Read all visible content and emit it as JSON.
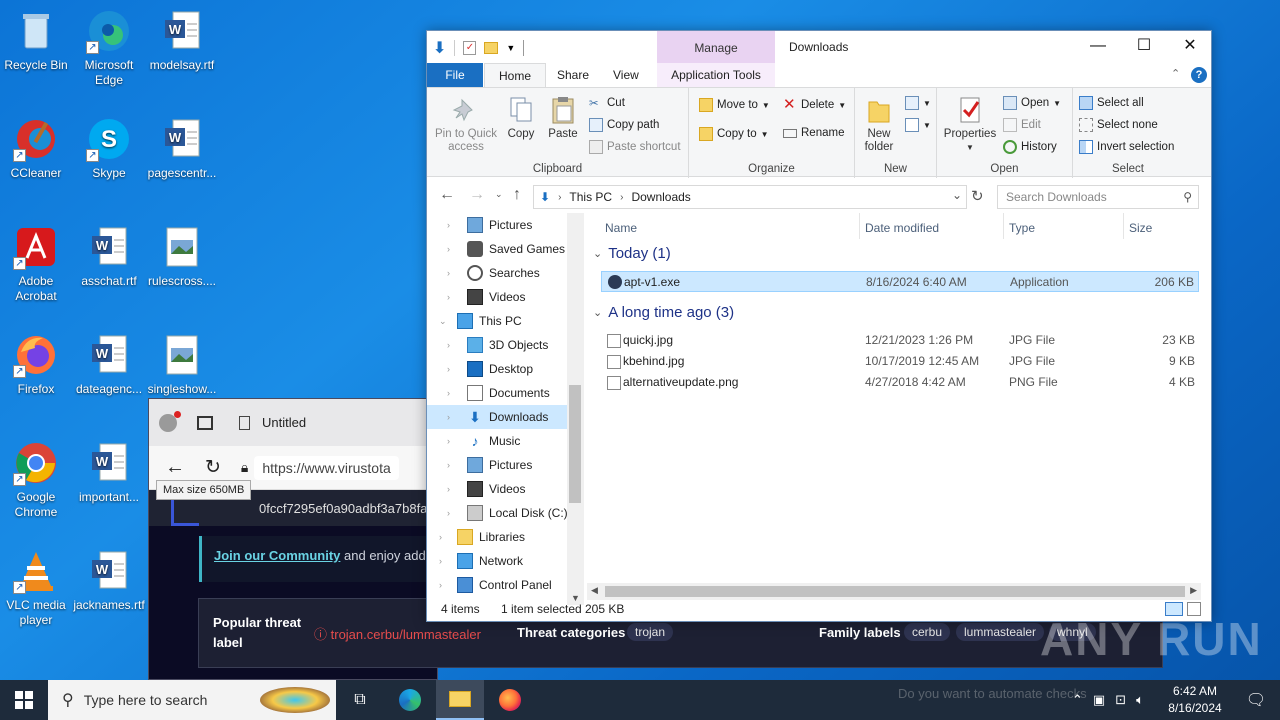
{
  "desktop": {
    "icons": [
      {
        "label": "Recycle Bin",
        "icon": "recycle-bin-icon"
      },
      {
        "label": "Microsoft Edge",
        "icon": "edge-icon"
      },
      {
        "label": "modelsay.rtf",
        "icon": "word-doc-icon"
      },
      {
        "label": "CCleaner",
        "icon": "ccleaner-icon"
      },
      {
        "label": "Skype",
        "icon": "skype-icon"
      },
      {
        "label": "pagescentr...",
        "icon": "word-doc-icon"
      },
      {
        "label": "Adobe Acrobat",
        "icon": "acrobat-icon"
      },
      {
        "label": "asschat.rtf",
        "icon": "word-doc-icon"
      },
      {
        "label": "rulescross....",
        "icon": "image-file-icon"
      },
      {
        "label": "Firefox",
        "icon": "firefox-icon"
      },
      {
        "label": "dateagenc...",
        "icon": "word-doc-icon"
      },
      {
        "label": "singleshow...",
        "icon": "image-file-icon"
      },
      {
        "label": "Google Chrome",
        "icon": "chrome-icon"
      },
      {
        "label": "important...",
        "icon": "word-doc-icon"
      },
      {
        "label": "VLC media player",
        "icon": "vlc-icon"
      },
      {
        "label": "jacknames.rtf",
        "icon": "word-doc-icon"
      }
    ]
  },
  "browser": {
    "tab_title": "Untitled",
    "url": "https://www.virustota",
    "tooltip": "Max size 650MB",
    "search_value": "0fccf7295ef0a90adbf3a7b8fa",
    "community_link": "Join our Community",
    "community_text": "and enjoy add"
  },
  "threat": {
    "popular_label": "Popular threat label",
    "tag": "trojan.cerbu/lummastealer",
    "categories_label": "Threat categories",
    "category": "trojan",
    "family_label": "Family labels",
    "families": [
      "cerbu",
      "lummastealer",
      "whnyl"
    ]
  },
  "watermark": "ANY RUN",
  "explorer": {
    "title": "Downloads",
    "manage_label": "Manage",
    "tabs": {
      "file": "File",
      "home": "Home",
      "share": "Share",
      "view": "View",
      "app_tools": "Application Tools"
    },
    "ribbon": {
      "clipboard": {
        "label": "Clipboard",
        "pin": "Pin to Quick access",
        "copy": "Copy",
        "paste": "Paste",
        "cut": "Cut",
        "copy_path": "Copy path",
        "paste_shortcut": "Paste shortcut"
      },
      "organize": {
        "label": "Organize",
        "move_to": "Move to",
        "copy_to": "Copy to",
        "delete": "Delete",
        "rename": "Rename"
      },
      "new": {
        "label": "New",
        "new_folder": "New folder"
      },
      "open": {
        "label": "Open",
        "properties": "Properties",
        "open": "Open",
        "edit": "Edit",
        "history": "History"
      },
      "select": {
        "label": "Select",
        "select_all": "Select all",
        "select_none": "Select none",
        "invert": "Invert selection"
      }
    },
    "address": {
      "root": "This PC",
      "folder": "Downloads",
      "search_placeholder": "Search Downloads"
    },
    "nav": [
      {
        "label": "Pictures",
        "indent": 1
      },
      {
        "label": "Saved Games",
        "indent": 1
      },
      {
        "label": "Searches",
        "indent": 1
      },
      {
        "label": "Videos",
        "indent": 1
      },
      {
        "label": "This PC",
        "indent": 0
      },
      {
        "label": "3D Objects",
        "indent": 1
      },
      {
        "label": "Desktop",
        "indent": 1
      },
      {
        "label": "Documents",
        "indent": 1
      },
      {
        "label": "Downloads",
        "indent": 1,
        "selected": true
      },
      {
        "label": "Music",
        "indent": 1
      },
      {
        "label": "Pictures",
        "indent": 1
      },
      {
        "label": "Videos",
        "indent": 1
      },
      {
        "label": "Local Disk (C:)",
        "indent": 1
      },
      {
        "label": "Libraries",
        "indent": 0
      },
      {
        "label": "Network",
        "indent": 0
      },
      {
        "label": "Control Panel",
        "indent": 0
      }
    ],
    "columns": {
      "name": "Name",
      "date": "Date modified",
      "type": "Type",
      "size": "Size"
    },
    "groups": [
      {
        "title": "Today (1)",
        "files": [
          {
            "name": "apt-v1.exe",
            "date": "8/16/2024 6:40 AM",
            "type": "Application",
            "size": "206 KB",
            "selected": true
          }
        ]
      },
      {
        "title": "A long time ago (3)",
        "files": [
          {
            "name": "quickj.jpg",
            "date": "12/21/2023 1:26 PM",
            "type": "JPG File",
            "size": "23 KB"
          },
          {
            "name": "kbehind.jpg",
            "date": "10/17/2019 12:45 AM",
            "type": "JPG File",
            "size": "9 KB"
          },
          {
            "name": "alternativeupdate.png",
            "date": "4/27/2018 4:42 AM",
            "type": "PNG File",
            "size": "4 KB"
          }
        ]
      }
    ],
    "status": {
      "count": "4 items",
      "selected": "1 item selected",
      "size": "205 KB"
    }
  },
  "taskbar": {
    "search_placeholder": "Type here to search",
    "time": "6:42 AM",
    "date": "8/16/2024",
    "ghost_text": "Do you want to automate checks"
  }
}
